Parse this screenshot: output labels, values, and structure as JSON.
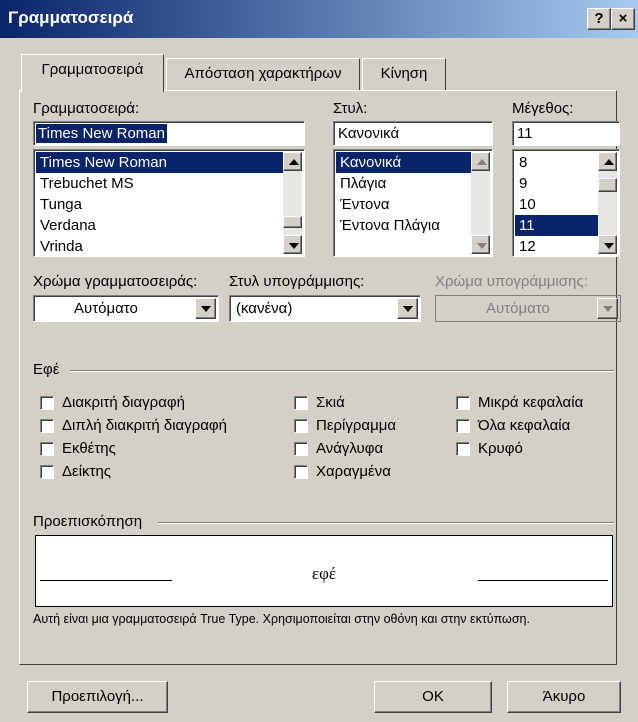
{
  "window": {
    "title": "Γραμματοσειρά",
    "help_btn": "?",
    "close_btn": "×"
  },
  "tabs": [
    {
      "label": "Γραμματοσειρά"
    },
    {
      "label": "Απόσταση χαρακτήρων"
    },
    {
      "label": "Κίνηση"
    }
  ],
  "font": {
    "label": "Γραμματοσειρά:",
    "value": "Times New Roman",
    "items": [
      "Times New Roman",
      "Trebuchet MS",
      "Tunga",
      "Verdana",
      "Vrinda"
    ],
    "selected": "Times New Roman"
  },
  "style": {
    "label": "Στυλ:",
    "value": "Κανονικά",
    "items": [
      "Κανονικά",
      "Πλάγια",
      "Έντονα",
      "Έντονα Πλάγια"
    ],
    "selected": "Κανονικά"
  },
  "size": {
    "label": "Μέγεθος:",
    "value": "11",
    "items": [
      "8",
      "9",
      "10",
      "11",
      "12"
    ],
    "selected": "11"
  },
  "font_color": {
    "label": "Χρώμα γραμματοσειράς:",
    "value": "Αυτόματο"
  },
  "underline_style": {
    "label": "Στυλ υπογράμμισης:",
    "value": "(κανένα)"
  },
  "underline_color": {
    "label": "Χρώμα υπογράμμισης:",
    "value": "Αυτόματο"
  },
  "effects": {
    "label": "Εφέ",
    "col1": [
      "Διακριτή διαγραφή",
      "Διπλή διακριτή διαγραφή",
      "Εκθέτης",
      "Δείκτης"
    ],
    "col2": [
      "Σκιά",
      "Περίγραμμα",
      "Ανάγλυφα",
      "Χαραγμένα"
    ],
    "col3": [
      "Μικρά κεφαλαία",
      "Όλα κεφαλαία",
      "Κρυφό"
    ]
  },
  "preview": {
    "label": "Προεπισκόπηση",
    "sample": "εφέ",
    "note": "Αυτή είναι μια γραμματοσειρά True Type. Χρησιμοποιείται στην οθόνη και στην εκτύπωση."
  },
  "buttons": {
    "default": "Προεπιλογή...",
    "ok": "OK",
    "cancel": "Άκυρο"
  }
}
